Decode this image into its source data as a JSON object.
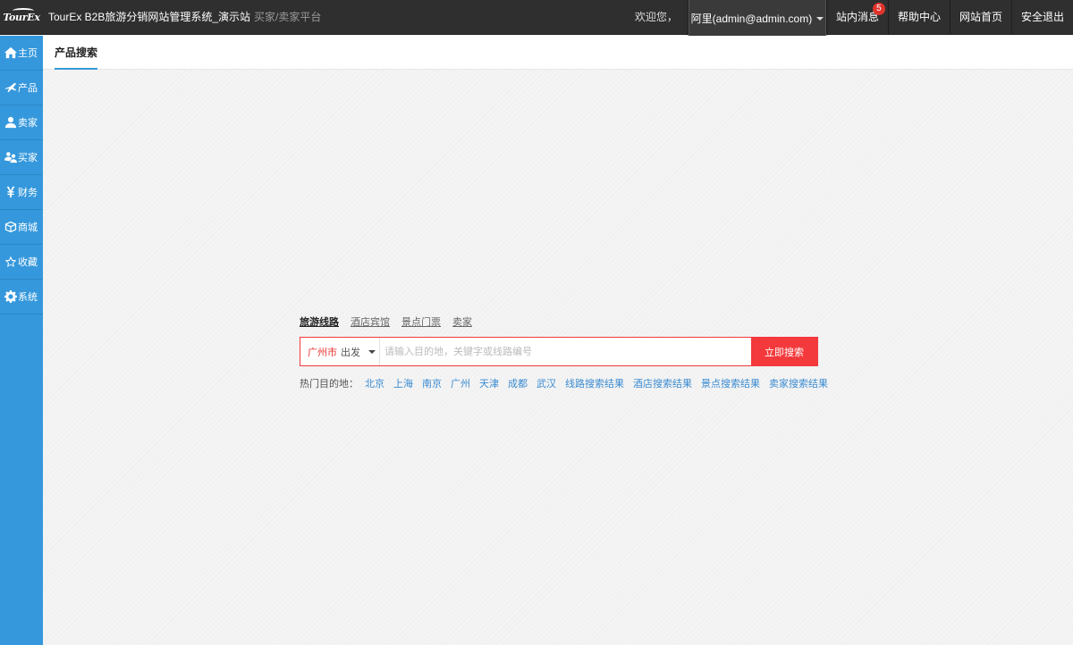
{
  "header": {
    "logo_text": "TourEx",
    "app_title": "TourEx B2B旅游分销网站管理系统_演示站",
    "app_subtitle": "买家/卖家平台",
    "welcome": "欢迎您，",
    "user": "阿里(admin@admin.com)",
    "nav": [
      {
        "label": "站内消息",
        "badge": "5"
      },
      {
        "label": "帮助中心"
      },
      {
        "label": "网站首页"
      },
      {
        "label": "安全退出"
      }
    ]
  },
  "sidebar": {
    "items": [
      {
        "label": "主页",
        "icon": "home-icon"
      },
      {
        "label": "产品",
        "icon": "plane-icon"
      },
      {
        "label": "卖家",
        "icon": "user-icon"
      },
      {
        "label": "买家",
        "icon": "users-icon"
      },
      {
        "label": "财务",
        "icon": "yen-icon"
      },
      {
        "label": "商城",
        "icon": "cube-icon"
      },
      {
        "label": "收藏",
        "icon": "star-icon"
      },
      {
        "label": "系统",
        "icon": "gear-icon"
      }
    ]
  },
  "page": {
    "title": "产品搜索"
  },
  "search": {
    "tabs": [
      "旅游线路",
      "酒店宾馆",
      "景点门票",
      "卖家"
    ],
    "active_tab": "旅游线路",
    "city": "广州市",
    "city_suffix": "出发",
    "placeholder": "请输入目的地，关键字或线路编号",
    "value": "",
    "button": "立即搜索",
    "hot_label": "热门目的地：",
    "hot_links": [
      "北京",
      "上海",
      "南京",
      "广州",
      "天津",
      "成都",
      "武汉",
      "线路搜索结果",
      "酒店搜索结果",
      "景点搜索结果",
      "卖家搜索结果"
    ]
  },
  "colors": {
    "topbar": "#2f2f2f",
    "sidebar": "#3598dc",
    "accent_red": "#f3393b",
    "link_blue": "#3a8bd1"
  }
}
